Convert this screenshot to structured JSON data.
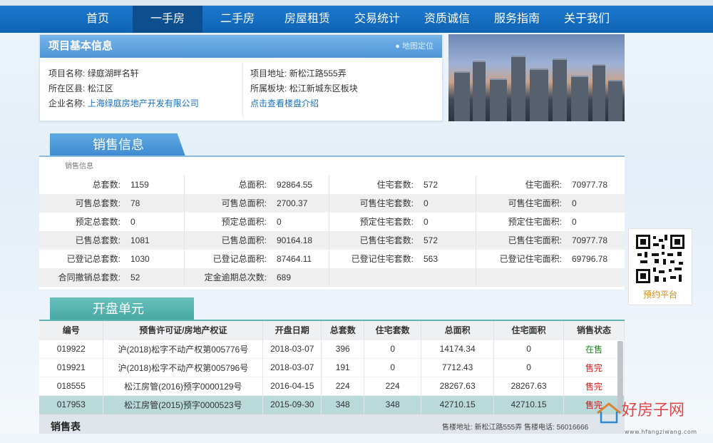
{
  "nav": [
    "首页",
    "一手房",
    "二手房",
    "房屋租赁",
    "交易统计",
    "资质诚信",
    "服务指南",
    "关于我们"
  ],
  "project": {
    "title": "项目基本信息",
    "map_link": "地图定位",
    "name_label": "项目名称:",
    "name": "绿庭湖畔名轩",
    "district_label": "所在区县:",
    "district": "松江区",
    "company_label": "企业名称:",
    "company": "上海绿庭房地产开发有限公司",
    "address_label": "项目地址:",
    "address": "新松江路555弄",
    "block_label": "所属板块:",
    "block": "松江新城东区板块",
    "intro_link": "点击查看楼盘介绍"
  },
  "sales": {
    "tab": "销售信息",
    "caption": "销售信息",
    "rows": [
      [
        [
          "总套数:",
          "1159"
        ],
        [
          "总面积:",
          "92864.55"
        ],
        [
          "住宅套数:",
          "572"
        ],
        [
          "住宅面积:",
          "70977.78"
        ]
      ],
      [
        [
          "可售总套数:",
          "78"
        ],
        [
          "可售总面积:",
          "2700.37"
        ],
        [
          "可售住宅套数:",
          "0"
        ],
        [
          "可售住宅面积:",
          "0"
        ]
      ],
      [
        [
          "预定总套数:",
          "0"
        ],
        [
          "预定总面积:",
          "0"
        ],
        [
          "预定住宅套数:",
          "0"
        ],
        [
          "预定住宅面积:",
          "0"
        ]
      ],
      [
        [
          "已售总套数:",
          "1081"
        ],
        [
          "已售总面积:",
          "90164.18"
        ],
        [
          "已售住宅套数:",
          "572"
        ],
        [
          "已售住宅面积:",
          "70977.78"
        ]
      ],
      [
        [
          "已登记总套数:",
          "1030"
        ],
        [
          "已登记总面积:",
          "87464.11"
        ],
        [
          "已登记住宅套数:",
          "563"
        ],
        [
          "已登记住宅面积:",
          "69796.78"
        ]
      ],
      [
        [
          "合同撤销总套数:",
          "52"
        ],
        [
          "定金逾期总次数:",
          "689"
        ],
        [
          "",
          ""
        ],
        [
          "",
          ""
        ]
      ]
    ]
  },
  "units": {
    "tab": "开盘单元",
    "headers": [
      "编号",
      "预售许可证/房地产权证",
      "开盘日期",
      "总套数",
      "住宅套数",
      "总面积",
      "住宅面积",
      "销售状态"
    ],
    "rows": [
      [
        "019922",
        "沪(2018)松字不动产权第005776号",
        "2018-03-07",
        "396",
        "0",
        "14174.34",
        "0",
        "在售"
      ],
      [
        "019921",
        "沪(2018)松字不动产权第005796号",
        "2018-03-07",
        "191",
        "0",
        "7712.43",
        "0",
        "售完"
      ],
      [
        "018555",
        "松江房管(2016)预字0000129号",
        "2016-04-15",
        "224",
        "224",
        "28267.63",
        "28267.63",
        "售完"
      ],
      [
        "017953",
        "松江房管(2015)预字0000523号",
        "2015-09-30",
        "348",
        "348",
        "42710.15",
        "42710.15",
        "售完"
      ]
    ]
  },
  "bottom": {
    "title": "销售表",
    "info": "售楼地址: 新松江路555弄  售楼电话: 56016666"
  },
  "qr": {
    "caption": "预约平台"
  },
  "watermark": {
    "text": "好房子网",
    "sub": "www.hfangziwang.com"
  },
  "colors": {
    "nav": "#1670c4",
    "nav_active": "#0d4f8e",
    "on_sale": "#1a8a1a",
    "sold_out": "#d41818"
  }
}
